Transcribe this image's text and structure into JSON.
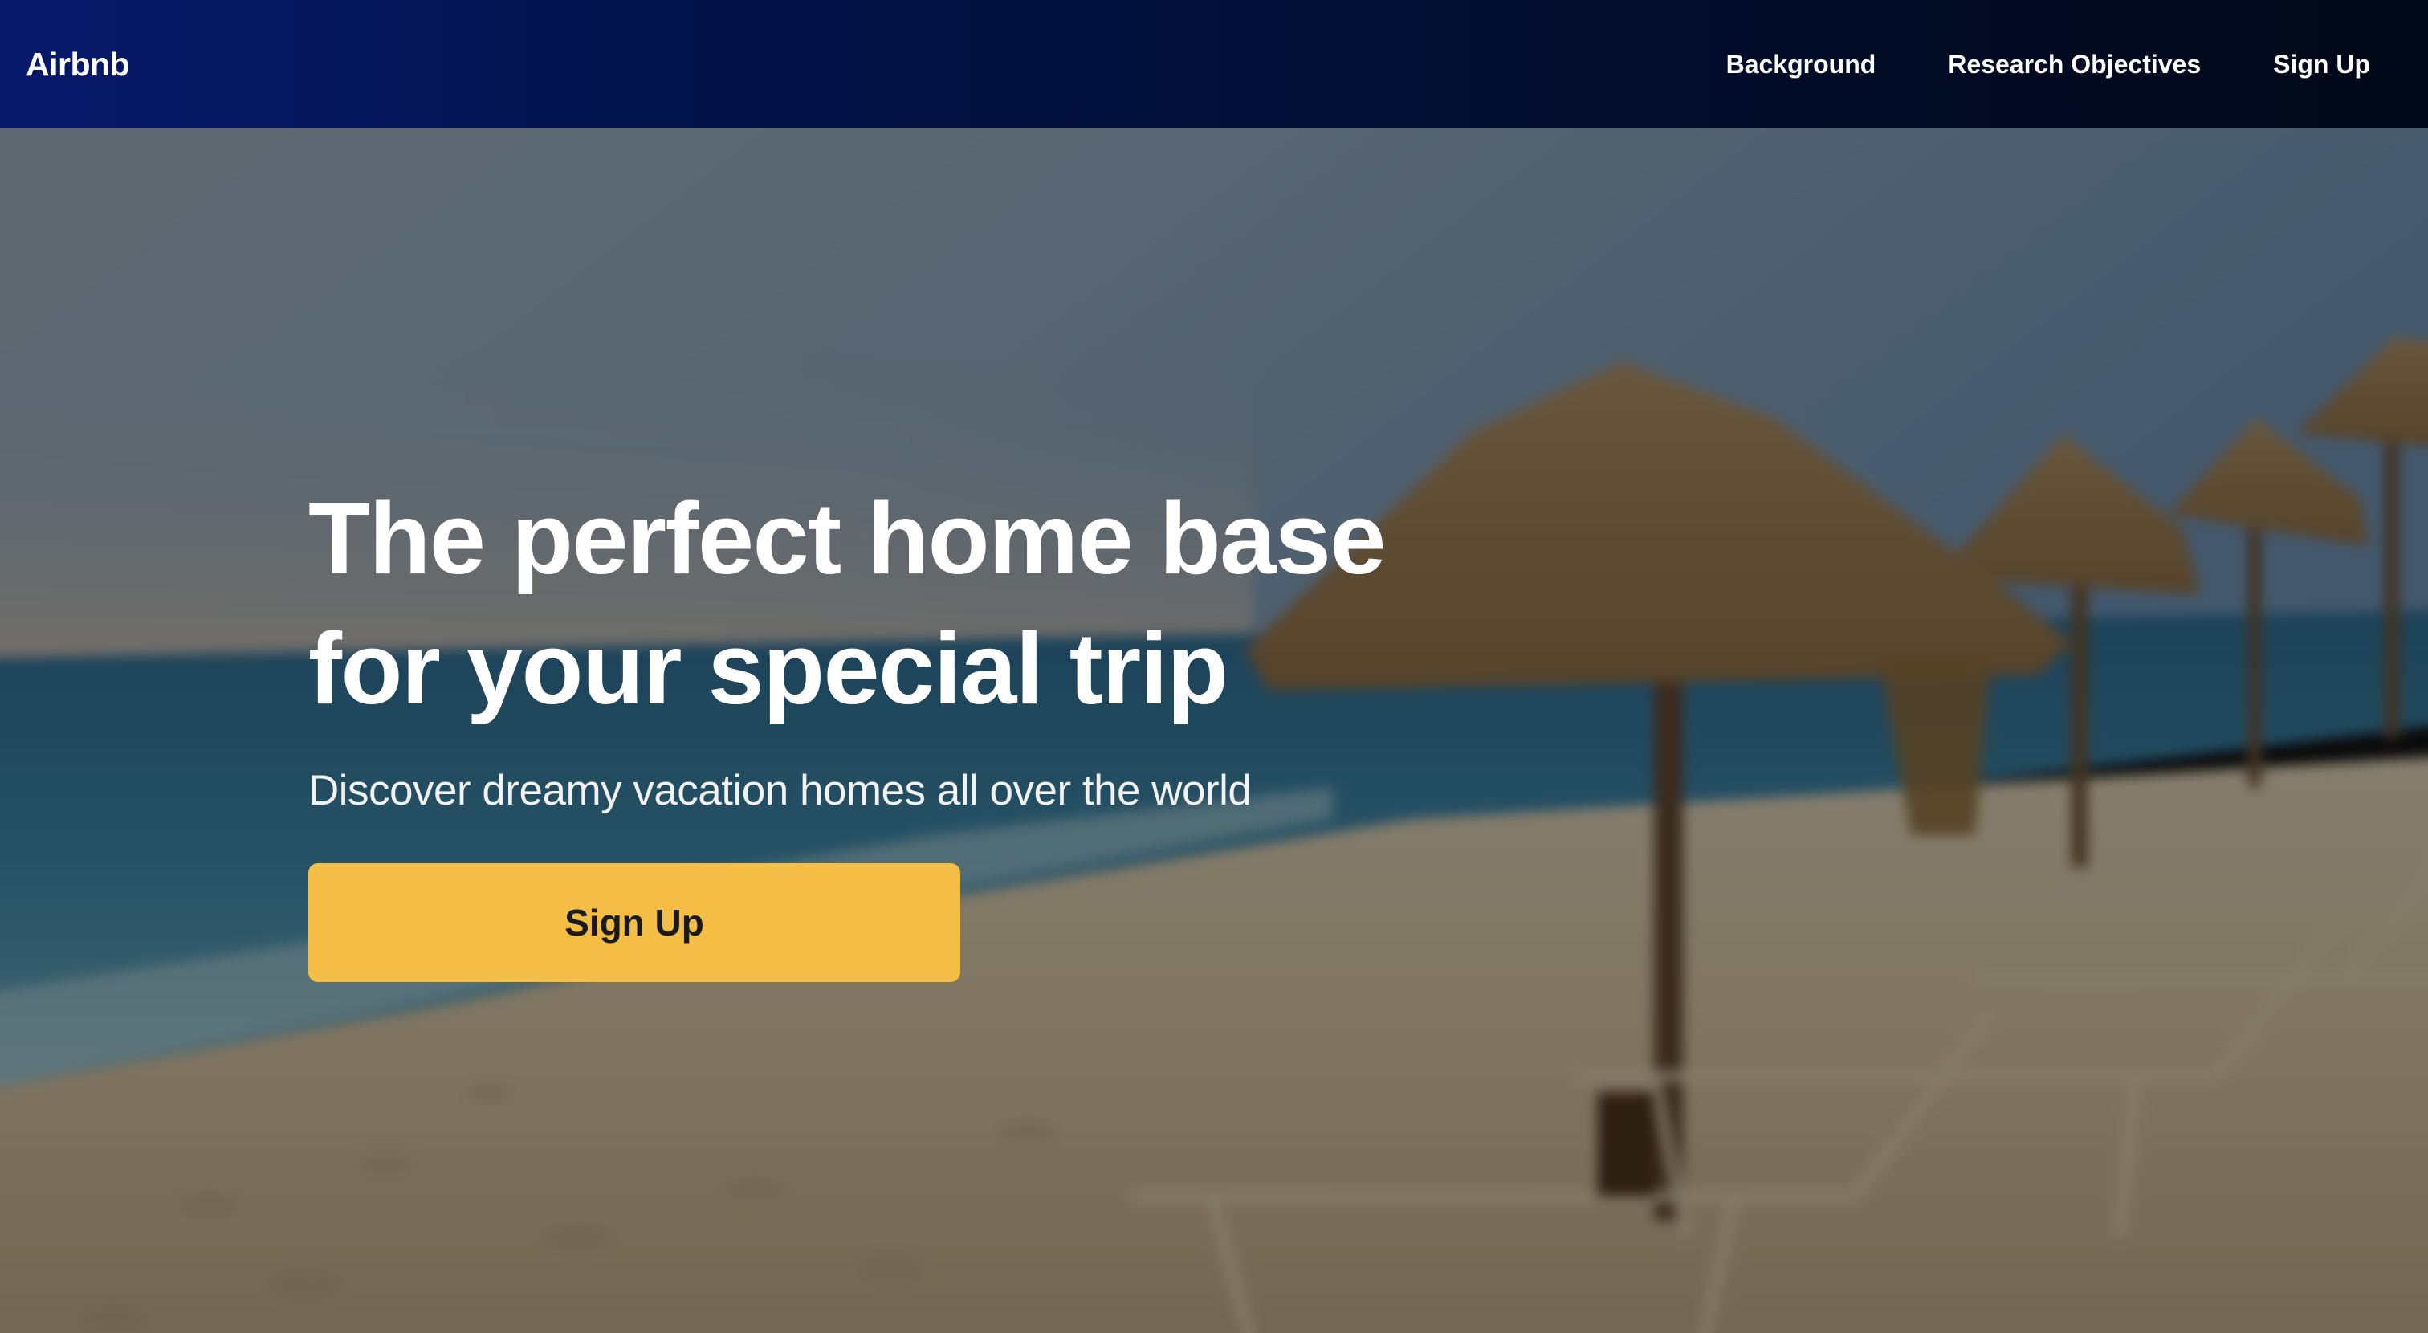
{
  "navbar": {
    "brand": "Airbnb",
    "links": [
      {
        "label": "Background"
      },
      {
        "label": "Research Objectives"
      },
      {
        "label": "Sign Up"
      }
    ]
  },
  "hero": {
    "headline": "The perfect home base for your special trip",
    "subheadline": "Discover dreamy vacation homes all over the world",
    "cta_label": "Sign Up",
    "background_image": "blurred-beach-with-palapa-umbrellas"
  },
  "colors": {
    "nav_gradient_start": "#06196b",
    "nav_gradient_end": "#010817",
    "cta_background": "#f4bd45",
    "cta_text": "#1a1a1a",
    "text_light": "#ffffff"
  }
}
